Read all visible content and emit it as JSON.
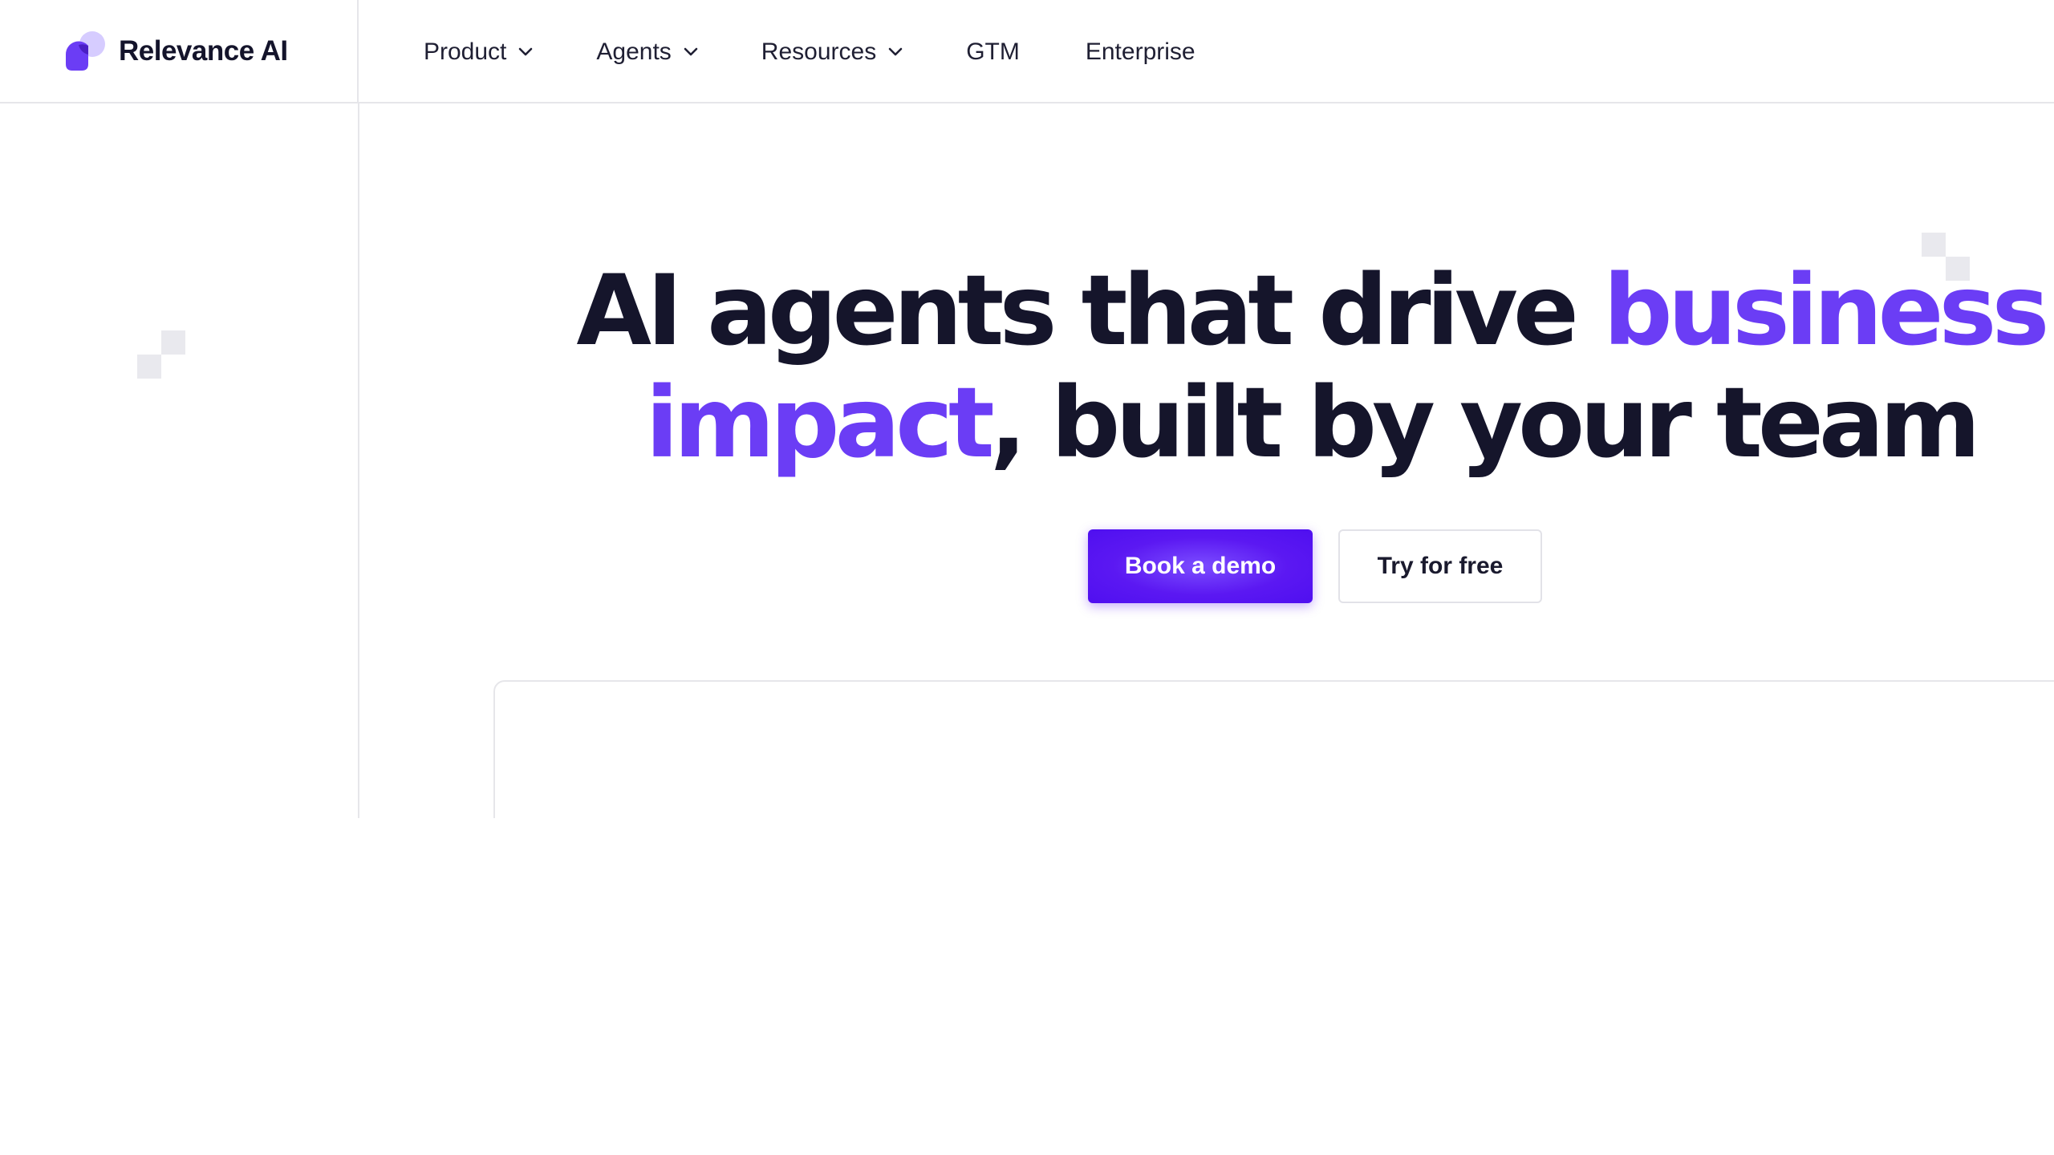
{
  "brand": {
    "name": "Relevance AI",
    "logo_icon": "relevance-logo-icon",
    "accent_color": "#6b3df5",
    "primary_button_color": "#5b18f2"
  },
  "nav": {
    "items": [
      {
        "label": "Product",
        "has_dropdown": true
      },
      {
        "label": "Agents",
        "has_dropdown": true
      },
      {
        "label": "Resources",
        "has_dropdown": true
      },
      {
        "label": "GTM",
        "has_dropdown": false
      },
      {
        "label": "Enterprise",
        "has_dropdown": false
      }
    ]
  },
  "hero": {
    "line1_plain": "AI agents that drive ",
    "line1_accent": "business",
    "line2_accent": "impact",
    "line2_plain": ", built by your team"
  },
  "cta": {
    "primary_label": "Book a demo",
    "secondary_label": "Try for free"
  }
}
